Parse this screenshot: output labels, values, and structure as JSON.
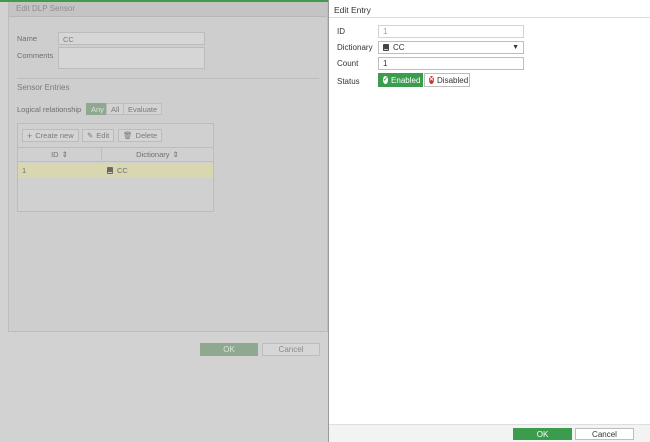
{
  "background_dialog": {
    "title": "Edit DLP Sensor",
    "name_label": "Name",
    "name_value": "CC",
    "comments_label": "Comments",
    "comments_value": "",
    "section_title": "Sensor Entries",
    "logical_label": "Logical relationship",
    "logical_options": [
      "Any",
      "All",
      "Evaluate"
    ],
    "toolbar": {
      "create_new": "Create new",
      "edit": "Edit",
      "delete": "Delete"
    },
    "columns": {
      "id": "ID",
      "dictionary": "Dictionary"
    },
    "rows": [
      {
        "id": "1",
        "dictionary": "CC"
      }
    ],
    "ok_label": "OK",
    "cancel_label": "Cancel"
  },
  "panel": {
    "title": "Edit Entry",
    "id_label": "ID",
    "id_value": "1",
    "dictionary_label": "Dictionary",
    "dictionary_value": "CC",
    "count_label": "Count",
    "count_value": "1",
    "status_label": "Status",
    "status_enabled": "Enabled",
    "status_disabled": "Disabled",
    "ok_label": "OK",
    "cancel_label": "Cancel"
  },
  "colors": {
    "accent": "#3c9c4e",
    "danger": "#cc3333"
  }
}
